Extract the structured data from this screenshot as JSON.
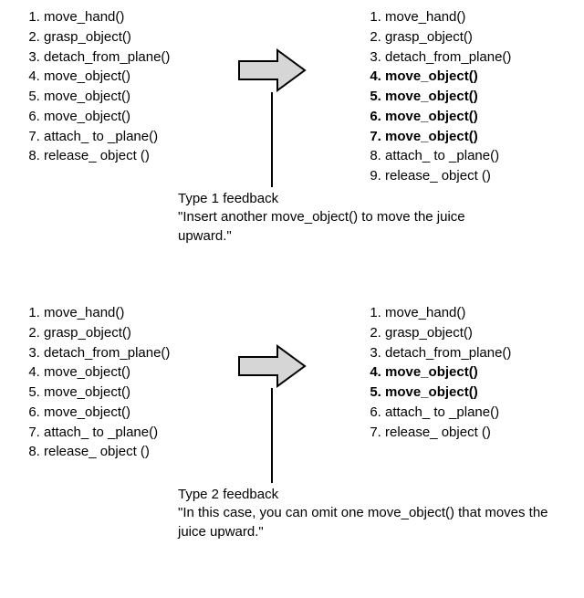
{
  "examples": [
    {
      "left_list": [
        {
          "text": "move_hand()",
          "bold": false
        },
        {
          "text": "grasp_object()",
          "bold": false
        },
        {
          "text": "detach_from_plane()",
          "bold": false
        },
        {
          "text": "move_object()",
          "bold": false
        },
        {
          "text": "move_object()",
          "bold": false
        },
        {
          "text": "move_object()",
          "bold": false
        },
        {
          "text": "attach_ to _plane()",
          "bold": false
        },
        {
          "text": "release_ object ()",
          "bold": false
        }
      ],
      "right_list": [
        {
          "text": "move_hand()",
          "bold": false
        },
        {
          "text": "grasp_object()",
          "bold": false
        },
        {
          "text": "detach_from_plane()",
          "bold": false
        },
        {
          "text": "move_object()",
          "bold": true
        },
        {
          "text": "move_object()",
          "bold": true
        },
        {
          "text": "move_object()",
          "bold": true
        },
        {
          "text": "move_object()",
          "bold": true
        },
        {
          "text": "attach_ to _plane()",
          "bold": false
        },
        {
          "text": "release_ object ()",
          "bold": false
        }
      ],
      "caption_title": "Type 1 feedback",
      "caption_body": "\"Insert another move_object() to move the juice upward.\""
    },
    {
      "left_list": [
        {
          "text": "move_hand()",
          "bold": false
        },
        {
          "text": "grasp_object()",
          "bold": false
        },
        {
          "text": "detach_from_plane()",
          "bold": false
        },
        {
          "text": "move_object()",
          "bold": false
        },
        {
          "text": "move_object()",
          "bold": false
        },
        {
          "text": "move_object()",
          "bold": false
        },
        {
          "text": "attach_ to _plane()",
          "bold": false
        },
        {
          "text": "release_ object ()",
          "bold": false
        }
      ],
      "right_list": [
        {
          "text": "move_hand()",
          "bold": false
        },
        {
          "text": "grasp_object()",
          "bold": false
        },
        {
          "text": "detach_from_plane()",
          "bold": false
        },
        {
          "text": "move_object()",
          "bold": true
        },
        {
          "text": "move_object()",
          "bold": true
        },
        {
          "text": "attach_ to _plane()",
          "bold": false
        },
        {
          "text": "release_ object ()",
          "bold": false
        }
      ],
      "caption_title": "Type 2 feedback",
      "caption_body": "\"In this case, you can omit one move_object() that moves the juice upward.\""
    }
  ]
}
